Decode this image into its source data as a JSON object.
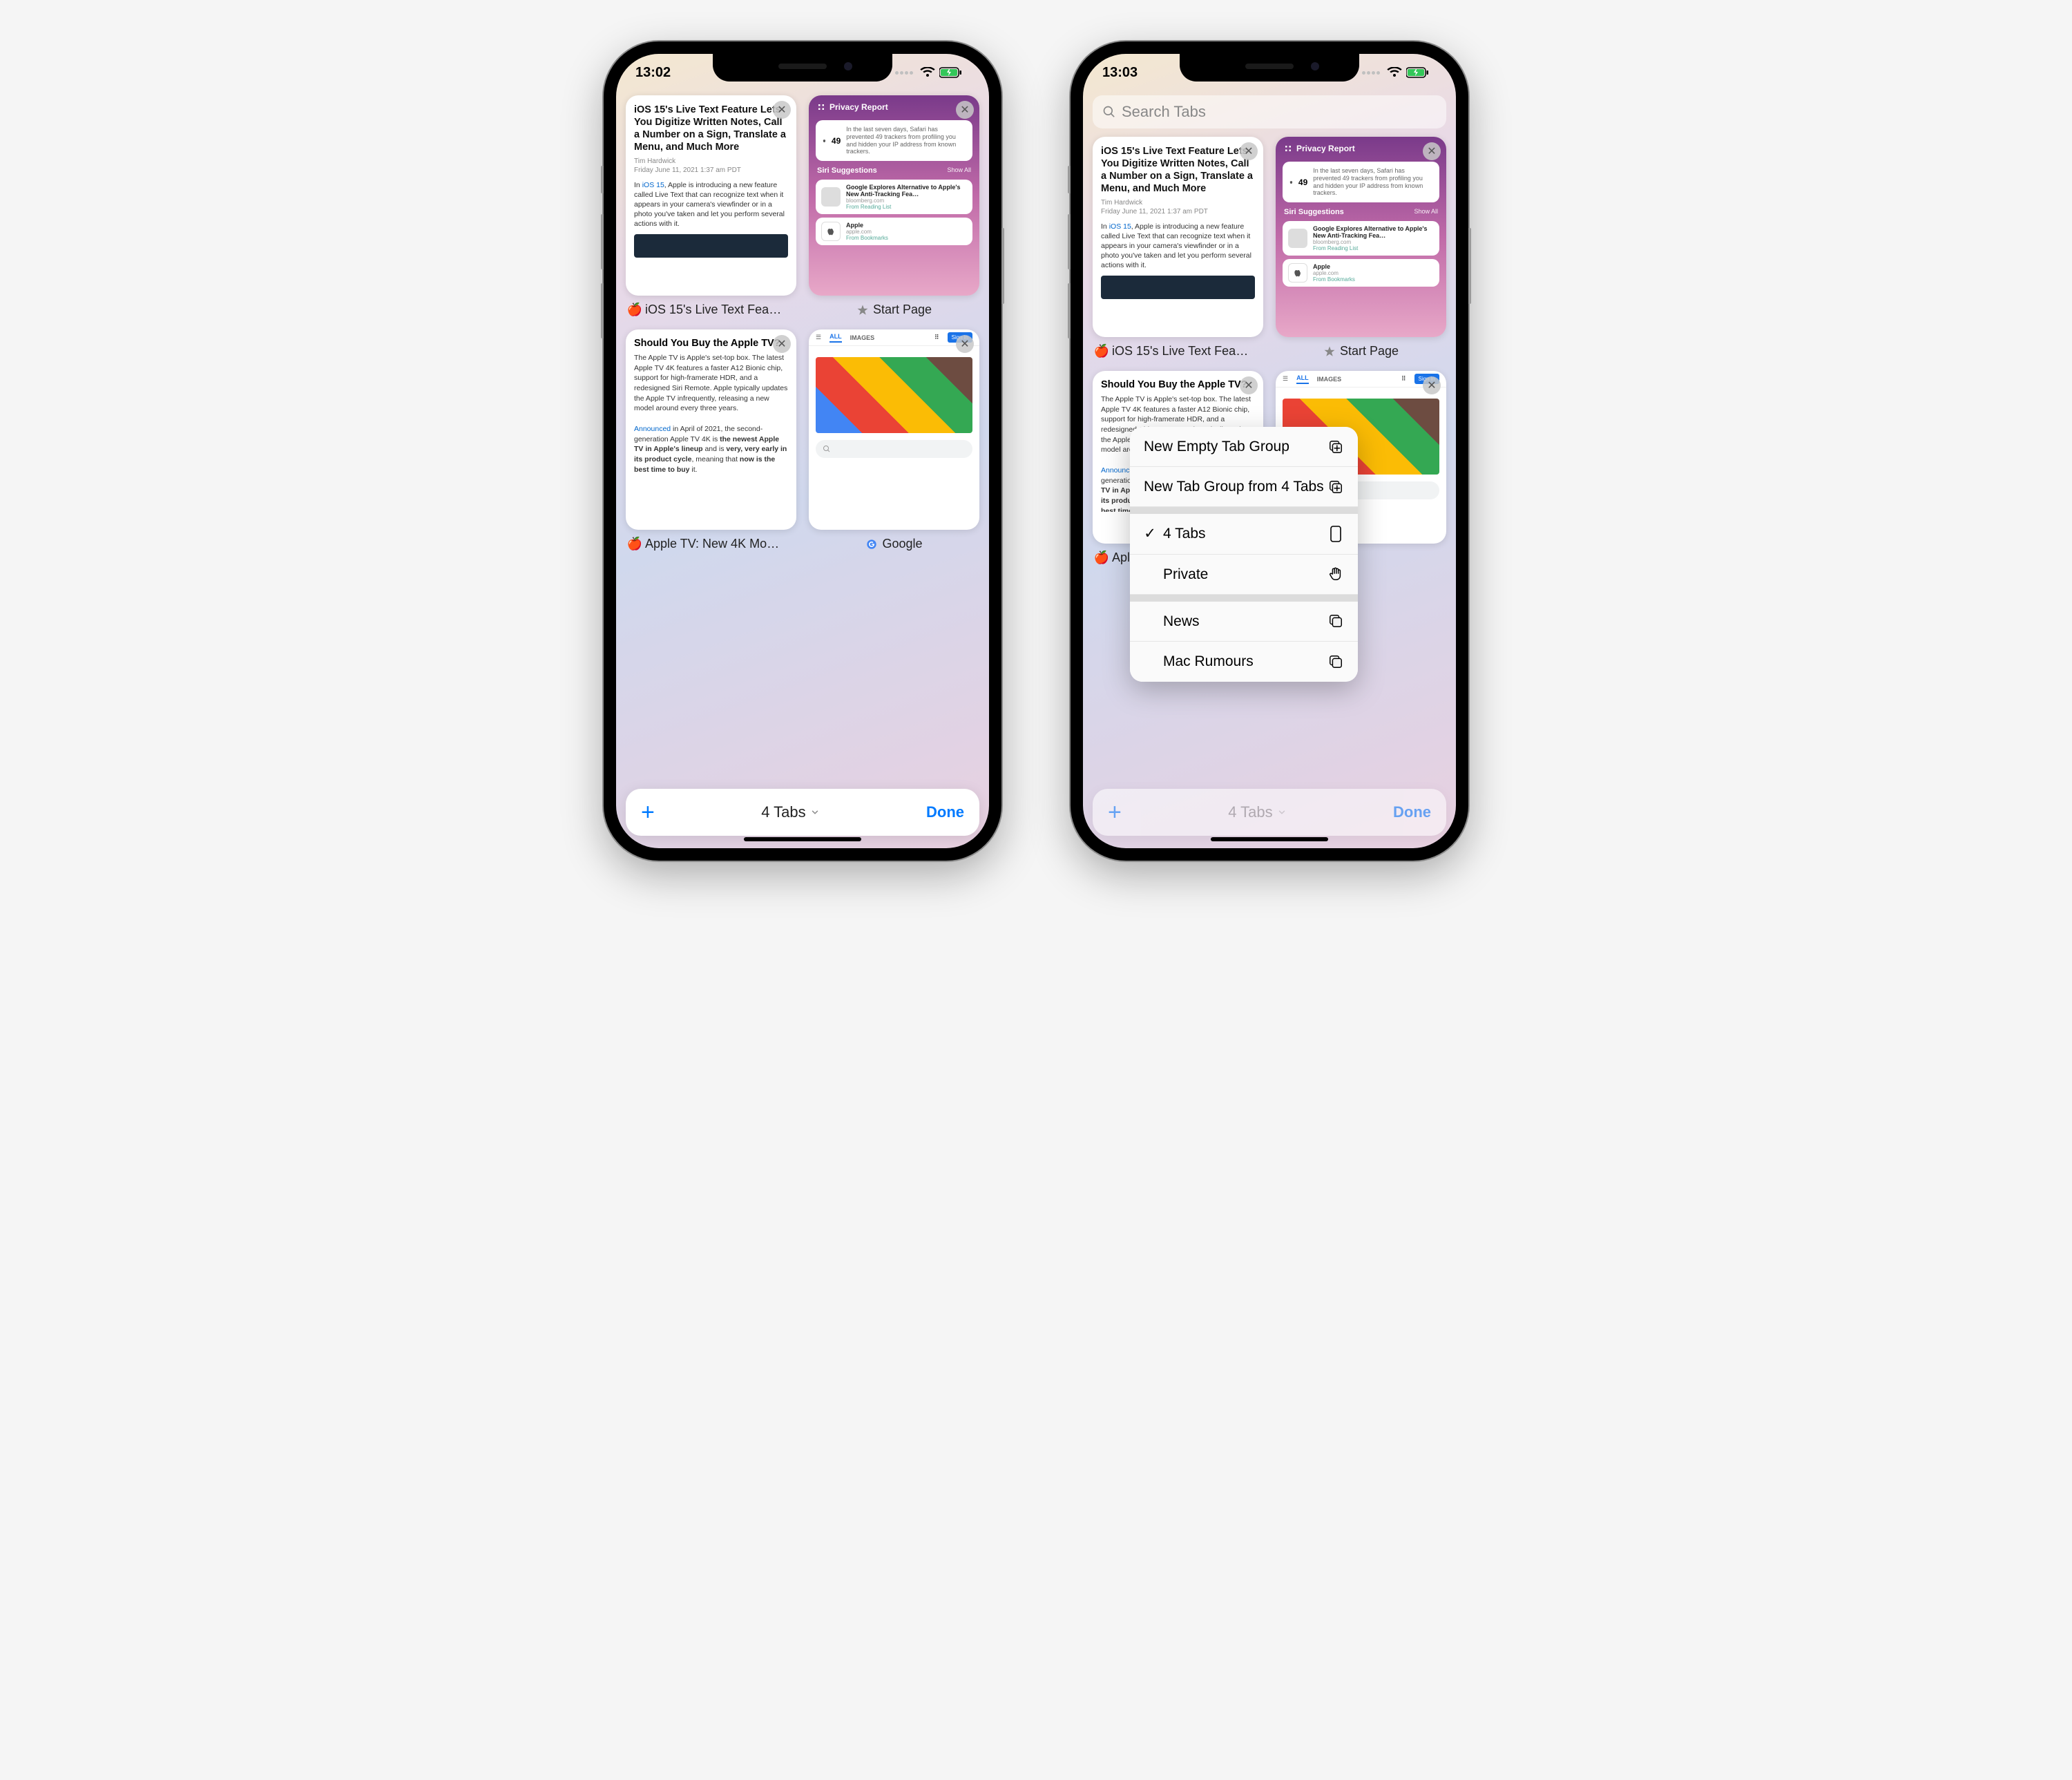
{
  "left": {
    "status_time": "13:02",
    "tabs": [
      {
        "title_full": "iOS 15's Live Text Feature Lets You Digitize Written Notes, Call a Number on a Sign, Translate a Menu, and Much More",
        "byline_author": "Tim Hardwick",
        "byline_date": "Friday June 11, 2021 1:37 am PDT",
        "body_prefix": "In ",
        "body_link": "iOS 15",
        "body_rest": ", Apple is introducing a new feature called Live Text that can recognize text when it appears in your camera's viewfinder or in a photo you've taken and let you perform several actions with it.",
        "label": "iOS 15's Live Text Fea…"
      },
      {
        "priv_head": "Privacy Report",
        "priv_count": "49",
        "priv_desc": "In the last seven days, Safari has prevented 49 trackers from profiling you and hidden your IP address from known trackers.",
        "siri_head": "Siri Suggestions",
        "siri_showall": "Show All",
        "sug1_title": "Google Explores Alternative to Apple's New Anti-Tracking Fea…",
        "sug1_sub": "bloomberg.com",
        "sug1_foot": "From Reading List",
        "sug2_title": "Apple",
        "sug2_sub": "apple.com",
        "sug2_foot": "From Bookmarks",
        "label": "Start Page"
      },
      {
        "title_full": "Should You Buy the Apple TV?",
        "para1": "The Apple TV is Apple's set-top box. The latest Apple TV 4K features a faster A12 Bionic chip, support for high-framerate HDR, and a redesigned Siri Remote. Apple typically updates the Apple TV infrequently, releasing a new model around every three years.",
        "p2_link": "Announced",
        "p2_mid1": " in April of 2021, the second-generation Apple TV 4K is ",
        "p2_b1": "the newest Apple TV in Apple's lineup",
        "p2_mid2": " and is ",
        "p2_b2": "very, very early in its product cycle",
        "p2_mid3": ", meaning that ",
        "p2_b3": "now is the best time to buy",
        "p2_end": " it.",
        "label": "Apple TV: New 4K Mo…"
      },
      {
        "g_tab_all": "ALL",
        "g_tab_images": "IMAGES",
        "g_signin": "Sign in",
        "label": "Google"
      }
    ],
    "bottom": {
      "center": "4 Tabs",
      "done": "Done"
    }
  },
  "right": {
    "status_time": "13:03",
    "search_placeholder": "Search Tabs",
    "tabs": [
      {
        "label": "iOS 15's Live Text Fea…"
      },
      {
        "label": "Start Page"
      },
      {
        "label_trunc": "Apl…"
      }
    ],
    "menu": {
      "new_empty": "New Empty Tab Group",
      "new_from": "New Tab Group from 4 Tabs",
      "current": "4 Tabs",
      "private": "Private",
      "grp1": "News",
      "grp2": "Mac Rumours"
    },
    "bottom": {
      "center": "4 Tabs",
      "done": "Done"
    }
  }
}
